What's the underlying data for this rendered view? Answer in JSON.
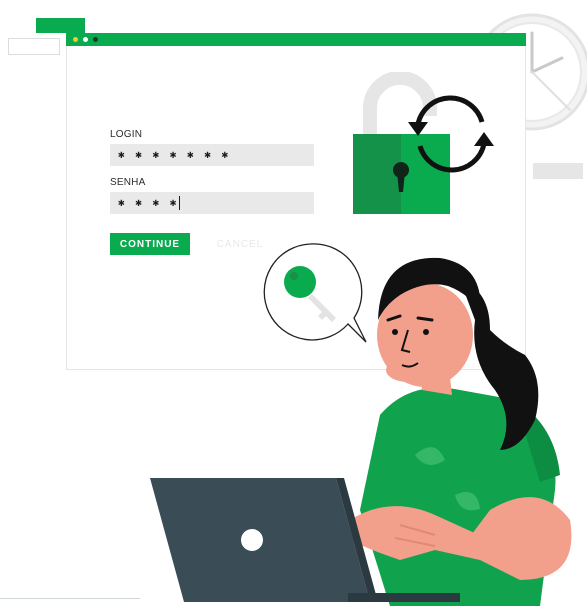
{
  "window": {
    "traffic_lights": [
      "#f7c52d",
      "#ffffff",
      "#1f3a2b"
    ]
  },
  "form": {
    "login_label": "LOGIN",
    "login_value": "✱ ✱ ✱ ✱ ✱ ✱ ✱",
    "password_label": "SENHA",
    "password_value": "✱ ✱ ✱ ✱",
    "continue_label": "CONTINUE",
    "cancel_label": "CANCEL"
  },
  "icons": [
    "padlock-icon",
    "refresh-arrows-icon",
    "clock-icon",
    "key-icon",
    "laptop-icon"
  ],
  "colors": {
    "brand_green": "#0aaa4f",
    "lock_dark": "#14924a",
    "skin": "#f2a08c",
    "hair": "#111111",
    "laptop": "#3a4c56"
  }
}
